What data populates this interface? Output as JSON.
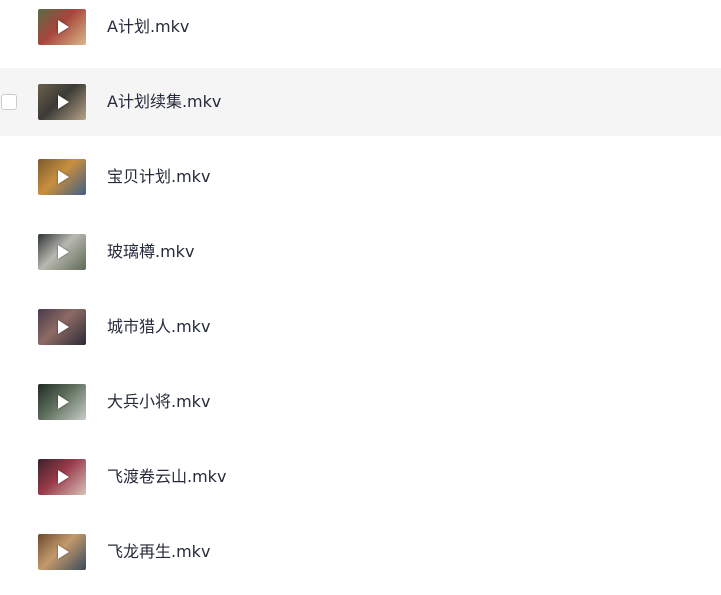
{
  "files": [
    {
      "name": "A计划.mkv",
      "thumb_colors": [
        "#5a6b45",
        "#a8443c",
        "#d9b98a"
      ]
    },
    {
      "name": "A计划续集.mkv",
      "thumb_colors": [
        "#6a5f4b",
        "#3b3a36",
        "#b7a489"
      ]
    },
    {
      "name": "宝贝计划.mkv",
      "thumb_colors": [
        "#7a5a2e",
        "#c98f3f",
        "#3f5f86"
      ]
    },
    {
      "name": "玻璃樽.mkv",
      "thumb_colors": [
        "#2e3436",
        "#b8b8b0",
        "#5d6a55"
      ]
    },
    {
      "name": "城市猎人.mkv",
      "thumb_colors": [
        "#4a3b4e",
        "#8e6a63",
        "#2a2b36"
      ]
    },
    {
      "name": "大兵小将.mkv",
      "thumb_colors": [
        "#1f2a24",
        "#5f6f5d",
        "#c6cdc8"
      ]
    },
    {
      "name": "飞渡卷云山.mkv",
      "thumb_colors": [
        "#3a2028",
        "#9a3a4a",
        "#d8c2b8"
      ]
    },
    {
      "name": "飞龙再生.mkv",
      "thumb_colors": [
        "#6b4a2e",
        "#c49a6c",
        "#3a4a5a"
      ]
    }
  ],
  "hovered_index": 1,
  "colors": {
    "text": "#252b3a",
    "row_hover": "#f5f5f6",
    "checkbox_border": "#c9ccd3"
  }
}
